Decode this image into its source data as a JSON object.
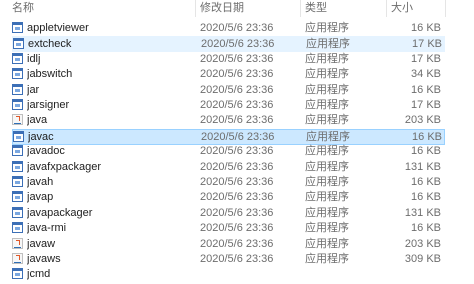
{
  "columns": {
    "name": "名称",
    "date": "修改日期",
    "type": "类型",
    "size": "大小"
  },
  "rows": [
    {
      "name": "appletviewer",
      "date": "2020/5/6 23:36",
      "type": "应用程序",
      "size": "16 KB",
      "icon": "exe-icon",
      "state": "normal"
    },
    {
      "name": "extcheck",
      "date": "2020/5/6 23:36",
      "type": "应用程序",
      "size": "17 KB",
      "icon": "exe-icon",
      "state": "hover"
    },
    {
      "name": "idlj",
      "date": "2020/5/6 23:36",
      "type": "应用程序",
      "size": "17 KB",
      "icon": "exe-icon",
      "state": "normal"
    },
    {
      "name": "jabswitch",
      "date": "2020/5/6 23:36",
      "type": "应用程序",
      "size": "34 KB",
      "icon": "exe-icon",
      "state": "normal"
    },
    {
      "name": "jar",
      "date": "2020/5/6 23:36",
      "type": "应用程序",
      "size": "16 KB",
      "icon": "exe-icon",
      "state": "normal"
    },
    {
      "name": "jarsigner",
      "date": "2020/5/6 23:36",
      "type": "应用程序",
      "size": "17 KB",
      "icon": "exe-icon",
      "state": "normal"
    },
    {
      "name": "java",
      "date": "2020/5/6 23:36",
      "type": "应用程序",
      "size": "203 KB",
      "icon": "java-icon",
      "state": "normal"
    },
    {
      "name": "javac",
      "date": "2020/5/6 23:36",
      "type": "应用程序",
      "size": "16 KB",
      "icon": "exe-icon",
      "state": "selected"
    },
    {
      "name": "javadoc",
      "date": "2020/5/6 23:36",
      "type": "应用程序",
      "size": "16 KB",
      "icon": "exe-icon",
      "state": "normal"
    },
    {
      "name": "javafxpackager",
      "date": "2020/5/6 23:36",
      "type": "应用程序",
      "size": "131 KB",
      "icon": "exe-icon",
      "state": "normal"
    },
    {
      "name": "javah",
      "date": "2020/5/6 23:36",
      "type": "应用程序",
      "size": "16 KB",
      "icon": "exe-icon",
      "state": "normal"
    },
    {
      "name": "javap",
      "date": "2020/5/6 23:36",
      "type": "应用程序",
      "size": "16 KB",
      "icon": "exe-icon",
      "state": "normal"
    },
    {
      "name": "javapackager",
      "date": "2020/5/6 23:36",
      "type": "应用程序",
      "size": "131 KB",
      "icon": "exe-icon",
      "state": "normal"
    },
    {
      "name": "java-rmi",
      "date": "2020/5/6 23:36",
      "type": "应用程序",
      "size": "16 KB",
      "icon": "exe-icon",
      "state": "normal"
    },
    {
      "name": "javaw",
      "date": "2020/5/6 23:36",
      "type": "应用程序",
      "size": "203 KB",
      "icon": "java-icon",
      "state": "normal"
    },
    {
      "name": "javaws",
      "date": "2020/5/6 23:36",
      "type": "应用程序",
      "size": "309 KB",
      "icon": "java-icon",
      "state": "normal"
    },
    {
      "name": "jcmd",
      "date": "",
      "type": "",
      "size": "",
      "icon": "exe-icon",
      "state": "normal"
    }
  ]
}
